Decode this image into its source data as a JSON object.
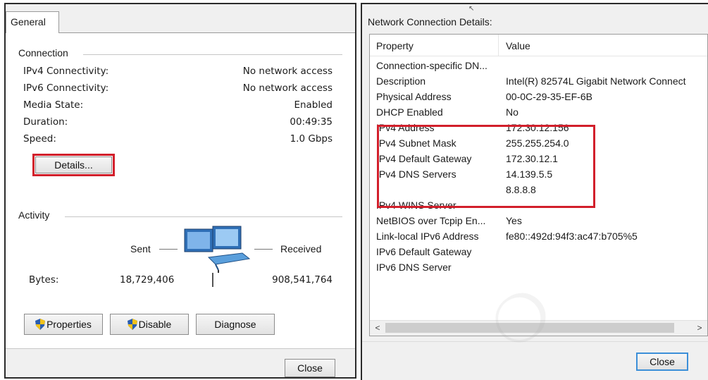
{
  "general_dialog": {
    "tab_label": "General",
    "connection": {
      "title": "Connection",
      "rows": [
        {
          "label": "IPv4 Connectivity:",
          "value": "No network access"
        },
        {
          "label": "IPv6 Connectivity:",
          "value": "No network access"
        },
        {
          "label": "Media State:",
          "value": "Enabled"
        },
        {
          "label": "Duration:",
          "value": "00:49:35"
        },
        {
          "label": "Speed:",
          "value": "1.0 Gbps"
        }
      ],
      "details_button": "Details..."
    },
    "activity": {
      "title": "Activity",
      "sent_label": "Sent",
      "received_label": "Received",
      "bytes_label": "Bytes:",
      "bytes_sent": "18,729,406",
      "bytes_received": "908,541,764",
      "network_icon": "network-computers-icon"
    },
    "buttons": {
      "properties": "Properties",
      "disable": "Disable",
      "diagnose": "Diagnose",
      "close": "Close"
    }
  },
  "details_dialog": {
    "caption": "Network Connection Details:",
    "columns": {
      "property": "Property",
      "value": "Value"
    },
    "rows": [
      {
        "property": "Connection-specific DN...",
        "value": ""
      },
      {
        "property": "Description",
        "value": "Intel(R) 82574L Gigabit Network Connect"
      },
      {
        "property": "Physical Address",
        "value": "00-0C-29-35-EF-6B"
      },
      {
        "property": "DHCP Enabled",
        "value": "No"
      },
      {
        "property": "IPv4 Address",
        "value": "172.30.12.156"
      },
      {
        "property": "IPv4 Subnet Mask",
        "value": "255.255.254.0"
      },
      {
        "property": "IPv4 Default Gateway",
        "value": "172.30.12.1"
      },
      {
        "property": "IPv4 DNS Servers",
        "value": "14.139.5.5"
      },
      {
        "property": "",
        "value": "8.8.8.8"
      },
      {
        "property": "IPv4 WINS Server",
        "value": ""
      },
      {
        "property": "NetBIOS over Tcpip En...",
        "value": "Yes"
      },
      {
        "property": "Link-local IPv6 Address",
        "value": "fe80::492d:94f3:ac47:b705%5"
      },
      {
        "property": "IPv6 Default Gateway",
        "value": ""
      },
      {
        "property": "IPv6 DNS Server",
        "value": ""
      }
    ],
    "scroll_left_glyph": "<",
    "scroll_right_glyph": ">",
    "close_button": "Close"
  },
  "colors": {
    "highlight": "#d21f2b",
    "close_focus": "#3c8fd8",
    "shield_blue": "#2a5db0",
    "shield_yellow": "#f2c21b"
  }
}
